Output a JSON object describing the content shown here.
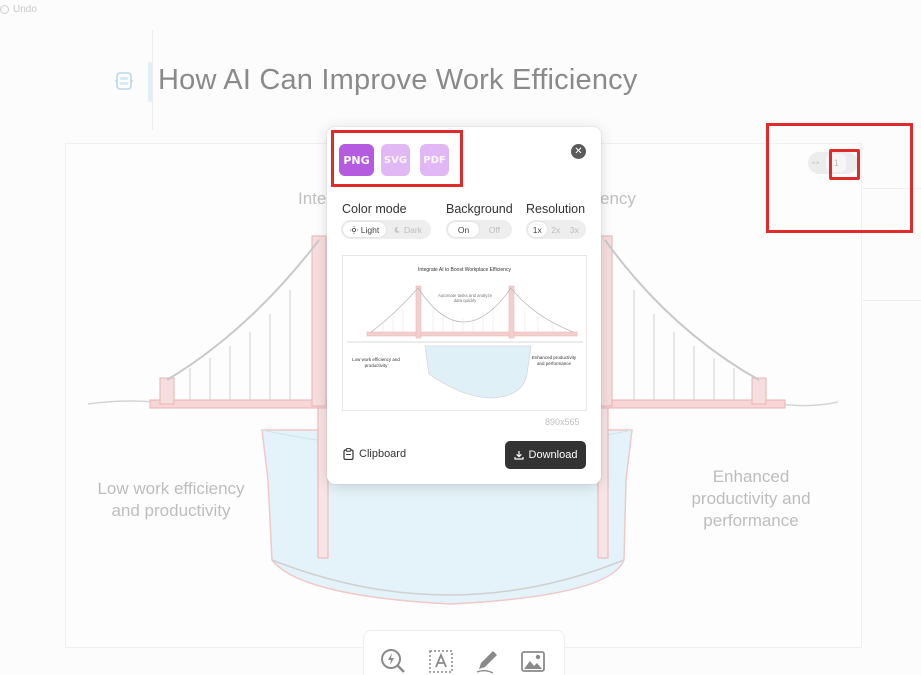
{
  "undo": {
    "label": "Undo"
  },
  "document": {
    "title": "How AI Can Improve Work Efficiency"
  },
  "background_graphic": {
    "top_label_left": "Inte",
    "top_label_right": "ency",
    "left_label": "Low work efficiency and productivity",
    "right_label": "Enhanced productivity and performance"
  },
  "export_popup": {
    "formats": [
      {
        "label": "PNG",
        "selected": true
      },
      {
        "label": "SVG",
        "selected": false
      },
      {
        "label": "PDF",
        "selected": false
      }
    ],
    "color_mode": {
      "label": "Color mode",
      "options": [
        "Light",
        "Dark"
      ],
      "selected": "Light"
    },
    "background": {
      "label": "Background",
      "options": [
        "On",
        "Off"
      ],
      "selected": "On"
    },
    "resolution": {
      "label": "Resolution",
      "options": [
        "1x",
        "2x",
        "3x"
      ],
      "selected": "1x"
    },
    "preview": {
      "title": "Integrate AI to Boost Workplace Efficiency",
      "subtitle": "Automate tasks and analyze data quickly",
      "left_text": "Low work efficiency and productivity",
      "right_text": "Enhanced productivity and performance"
    },
    "dimensions": "890x565",
    "clipboard_label": "Clipboard",
    "download_label": "Download"
  },
  "mini_toggle": {
    "left": "••",
    "right": "1"
  },
  "colors": {
    "format_selected": "#b45be0",
    "format_unselected": "#e1b8f3",
    "download_bg": "#333333",
    "highlight_red": "#e12a2a",
    "bridge_red": "#f0b8b8",
    "water_blue": "#d7eef7"
  },
  "icons": [
    "undo-icon",
    "title-logo-icon",
    "close-icon",
    "sun-icon",
    "moon-icon",
    "clipboard-icon",
    "download-icon",
    "magic-zoom-icon",
    "text-box-icon",
    "pen-icon",
    "image-icon"
  ]
}
